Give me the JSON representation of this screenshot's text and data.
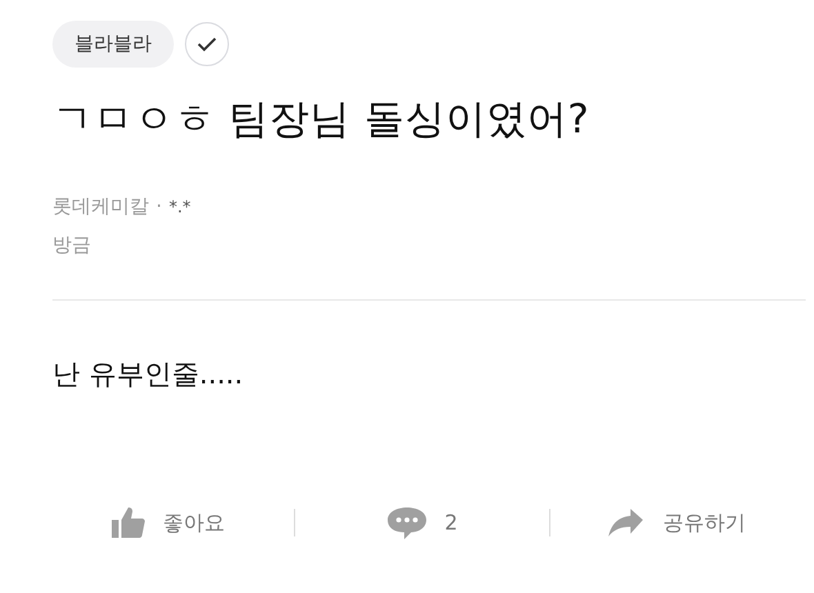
{
  "tag": "블라블라",
  "title": "ㄱㅁㅇㅎ 팀장님 돌싱이였어?",
  "author": {
    "company": "롯데케미칼",
    "separator": "·",
    "nickname": "*.*"
  },
  "time": "방금",
  "body": "난 유부인줄.....",
  "actions": [
    {
      "kind": "like",
      "label": "좋아요"
    },
    {
      "kind": "comment",
      "label": "2"
    },
    {
      "kind": "share",
      "label": "공유하기"
    }
  ]
}
